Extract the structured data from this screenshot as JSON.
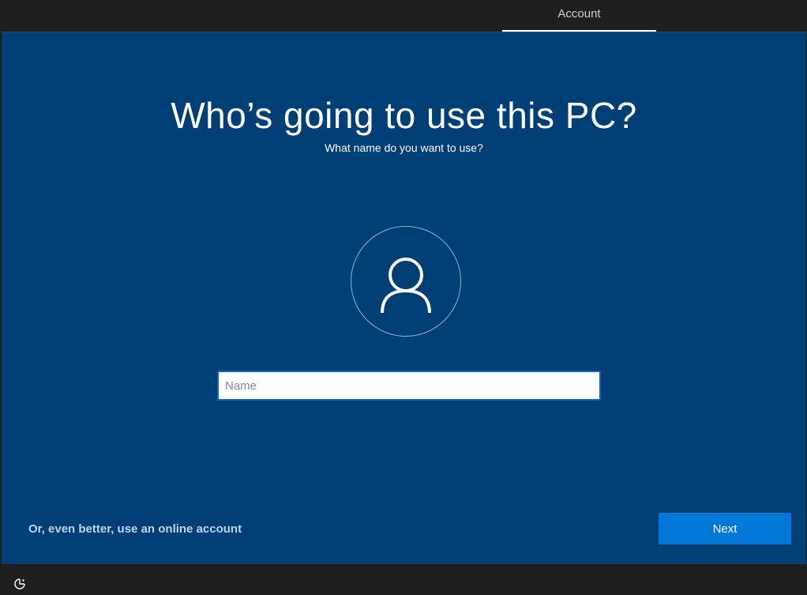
{
  "topbar": {
    "active_tab": "Account"
  },
  "main": {
    "title": "Who’s going to use this PC?",
    "subtitle": "What name do you want to use?",
    "avatar_icon": "user-icon",
    "name_input": {
      "value": "",
      "placeholder": "Name"
    },
    "online_account_link": "Or, even better, use an online account",
    "next_label": "Next"
  },
  "bottombar": {
    "icon": "ease-of-access-icon"
  },
  "colors": {
    "background": "#003f76",
    "chrome": "#1f1f1f",
    "accent": "#0078d7",
    "link": "#bcd6f2"
  }
}
